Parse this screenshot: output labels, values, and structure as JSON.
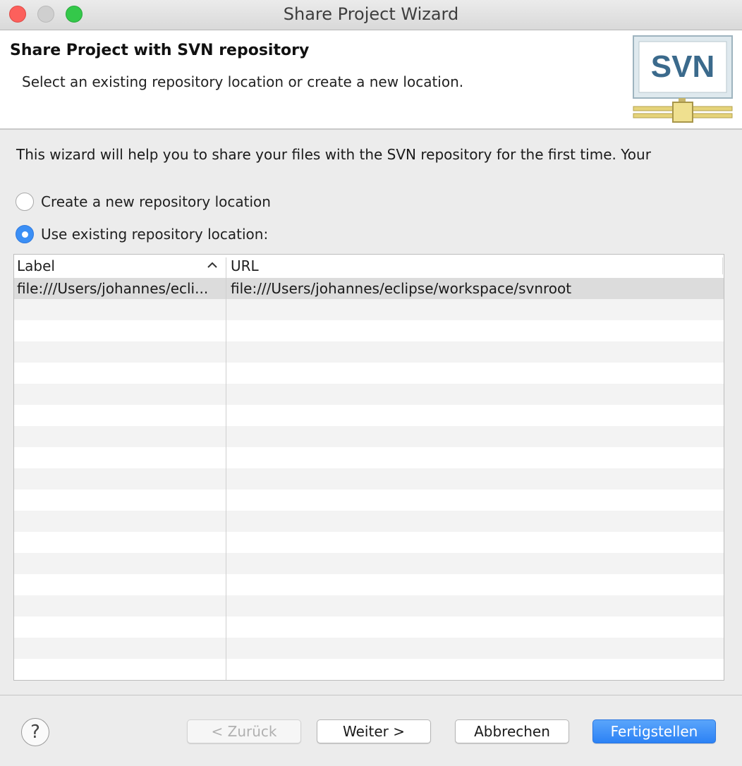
{
  "window": {
    "title": "Share Project Wizard"
  },
  "header": {
    "title": "Share Project with SVN repository",
    "description": "Select an existing repository location or create a new location.",
    "logo_text": "SVN"
  },
  "intro": "This wizard will help you to share your files with the SVN repository for the first time. Your",
  "options": {
    "create_new": {
      "label": "Create a new repository location",
      "selected": false
    },
    "use_existing": {
      "label": "Use existing repository location:",
      "selected": true
    }
  },
  "table": {
    "columns": {
      "label": "Label",
      "url": "URL"
    },
    "sort_indicator": "sort-ascending-icon",
    "rows": [
      {
        "label": "file:///Users/johannes/ecli...",
        "url": "file:///Users/johannes/eclipse/workspace/svnroot",
        "selected": true
      }
    ]
  },
  "buttons": {
    "back": "< Zurück",
    "next": "Weiter >",
    "cancel": "Abbrechen",
    "finish": "Fertigstellen"
  },
  "help_glyph": "?",
  "colors": {
    "accent": "#3b8ff5",
    "close": "#fc605c",
    "maximize": "#34c84a",
    "selection": "#dcdcdc"
  }
}
